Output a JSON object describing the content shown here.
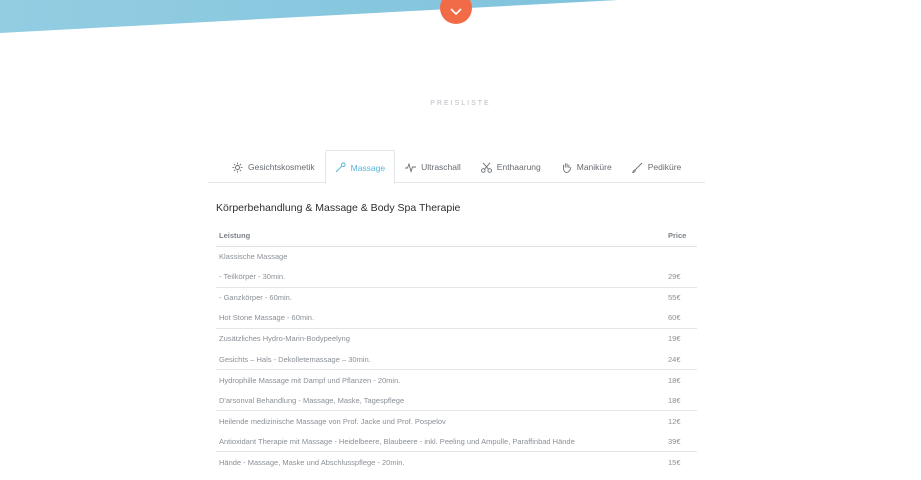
{
  "colors": {
    "accent": "#59b7d9",
    "button": "#f26b47",
    "band": "#8ecbe0"
  },
  "hero": {
    "scroll_icon": "chevron-down-icon"
  },
  "section": {
    "label": "PREISLISTE"
  },
  "tabs": [
    {
      "label": "Gesichtskosmetik",
      "icon": "sparkle-icon",
      "active": false
    },
    {
      "label": "Massage",
      "icon": "massage-wand-icon",
      "active": true
    },
    {
      "label": "Ultraschall",
      "icon": "pulse-icon",
      "active": false
    },
    {
      "label": "Enthaarung",
      "icon": "scissors-icon",
      "active": false
    },
    {
      "label": "Maniküre",
      "icon": "hand-icon",
      "active": false
    },
    {
      "label": "Pediküre",
      "icon": "brush-icon",
      "active": false
    }
  ],
  "table": {
    "title": "Körperbehandlung & Massage & Body Spa Therapie",
    "headers": {
      "service": "Leistung",
      "price": "Price"
    },
    "rows": [
      {
        "service": "Klassische Massage",
        "price": ""
      },
      {
        "service": "- Teilkörper - 30min.",
        "price": "29€"
      },
      {
        "service": "- Ganzkörper - 60min.",
        "price": "55€"
      },
      {
        "service": "Hot Stone Massage - 60min.",
        "price": "60€"
      },
      {
        "service": "Zusätzliches Hydro-Marin-Bodypeelyng",
        "price": "19€"
      },
      {
        "service": "Gesichts – Hals - Dekolletemassage – 30min.",
        "price": "24€"
      },
      {
        "service": "Hydrophille Massage mit Dampf und Pflanzen - 20min.",
        "price": "18€"
      },
      {
        "service": "D'arsonval Behandlung - Massage, Maske, Tagespflege",
        "price": "18€"
      },
      {
        "service": "Heilende medizinische Massage von Prof. Jacke und Prof. Pospelov",
        "price": "12€"
      },
      {
        "service": "Antioxidant Therapie mit Massage - Heidelbeere, Blaubeere - inkl. Peeling und Ampulle, Paraffinbad Hände",
        "price": "39€"
      },
      {
        "service": "Hände - Massage, Maske und Abschlusspflege - 20min.",
        "price": "15€"
      }
    ]
  }
}
